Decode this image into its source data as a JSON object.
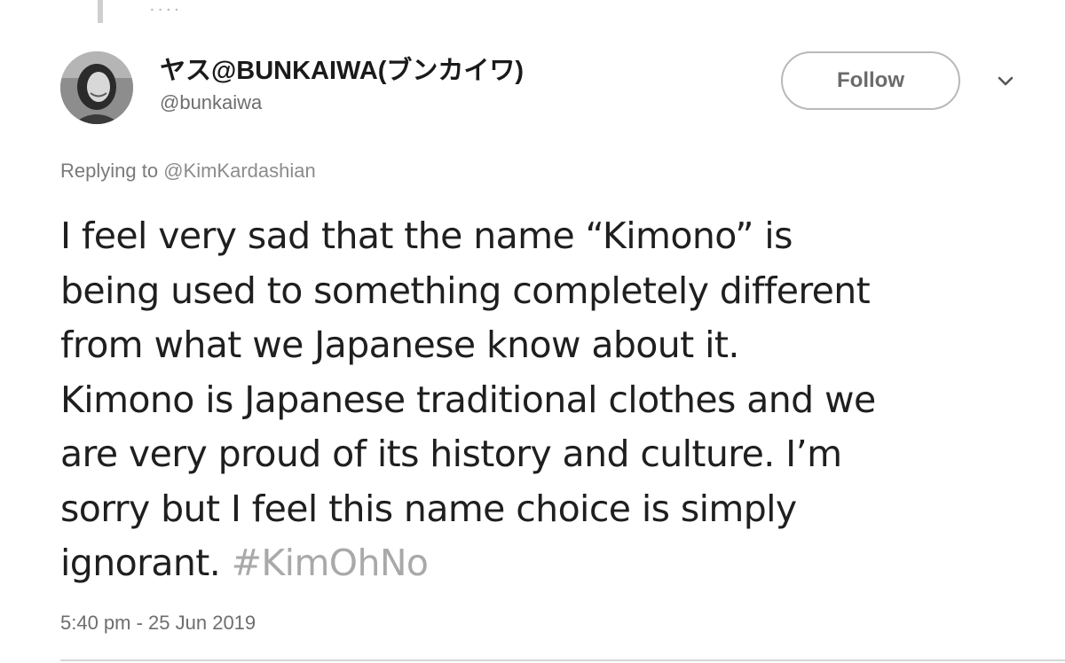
{
  "tweet": {
    "author": {
      "display_name": "ヤス@BUNKAIWA(ブンカイワ)",
      "handle": "@bunkaiwa"
    },
    "follow_label": "Follow",
    "menu_icon": "chevron-down-icon",
    "replying_prefix": "Replying to",
    "replying_to": "@KimKardashian",
    "text_lines": [
      "I feel very sad that the name “Kimono” is",
      "being used to something completely different",
      "from what we Japanese know about it.",
      "Kimono is Japanese traditional clothes and we",
      "are very proud of its history and culture. I’m",
      "sorry but I feel this name choice is simply",
      "ignorant. "
    ],
    "hashtag": "#KimOhNo",
    "timestamp": "5:40 pm - 25 Jun 2019"
  },
  "colors": {
    "text": "#1f1f1f",
    "muted": "#6e6e6e",
    "hashtag": "#a9a9a9",
    "border": "#b9b9b9"
  }
}
